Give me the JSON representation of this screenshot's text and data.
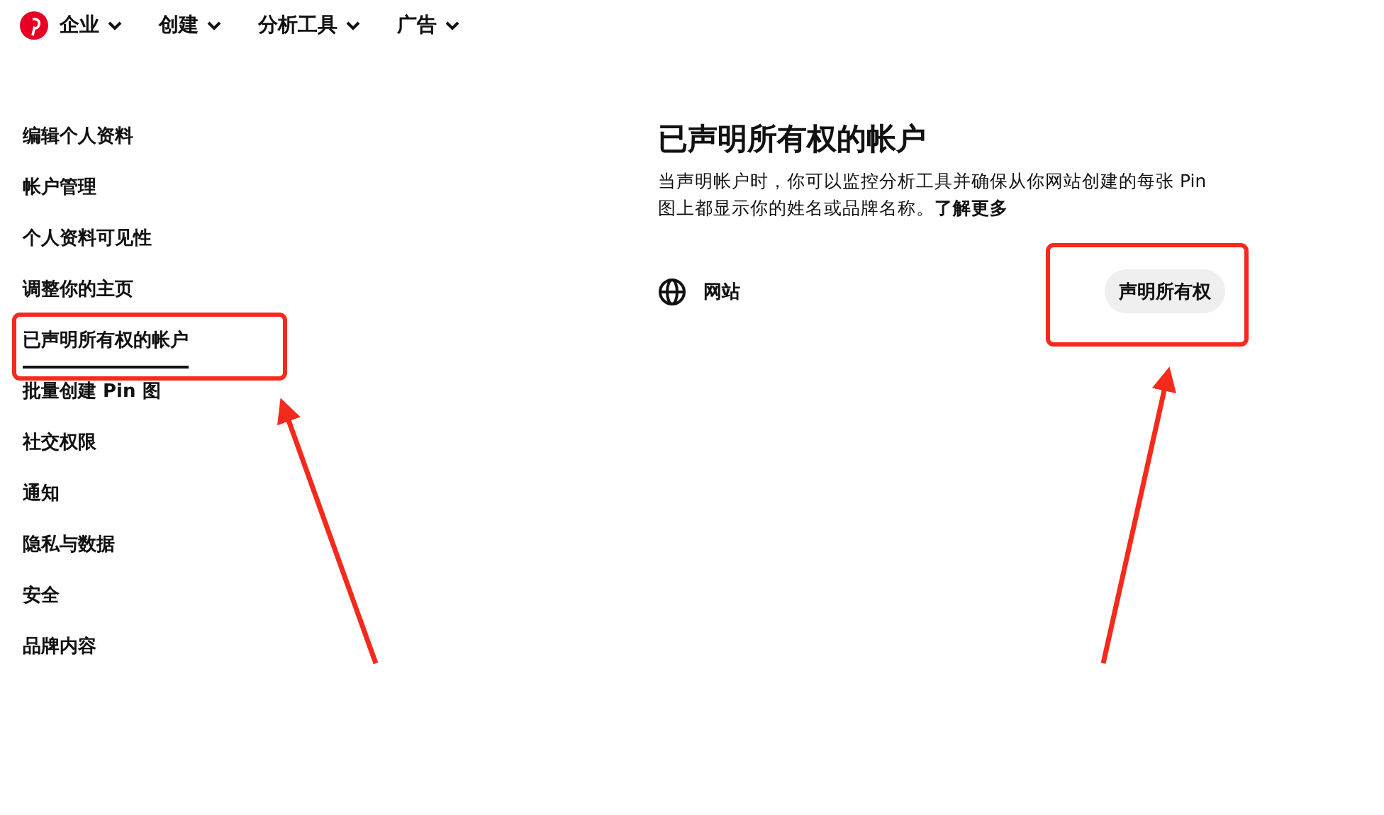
{
  "nav": [
    {
      "label": "企业"
    },
    {
      "label": "创建"
    },
    {
      "label": "分析工具"
    },
    {
      "label": "广告"
    }
  ],
  "sidebar": {
    "items": [
      {
        "label": "编辑个人资料",
        "selected": false
      },
      {
        "label": "帐户管理",
        "selected": false
      },
      {
        "label": "个人资料可见性",
        "selected": false
      },
      {
        "label": "调整你的主页",
        "selected": false
      },
      {
        "label": "已声明所有权的帐户",
        "selected": true
      },
      {
        "label": "批量创建 Pin 图",
        "selected": false
      },
      {
        "label": "社交权限",
        "selected": false
      },
      {
        "label": "通知",
        "selected": false
      },
      {
        "label": "隐私与数据",
        "selected": false
      },
      {
        "label": "安全",
        "selected": false
      },
      {
        "label": "品牌内容",
        "selected": false
      }
    ]
  },
  "main": {
    "title": "已声明所有权的帐户",
    "description": "当声明帐户时，你可以监控分析工具并确保从你网站创建的每张 Pin 图上都显示你的姓名或品牌名称。",
    "link": "了解更多",
    "rows": [
      {
        "label": "网站",
        "button": "声明所有权"
      }
    ]
  }
}
